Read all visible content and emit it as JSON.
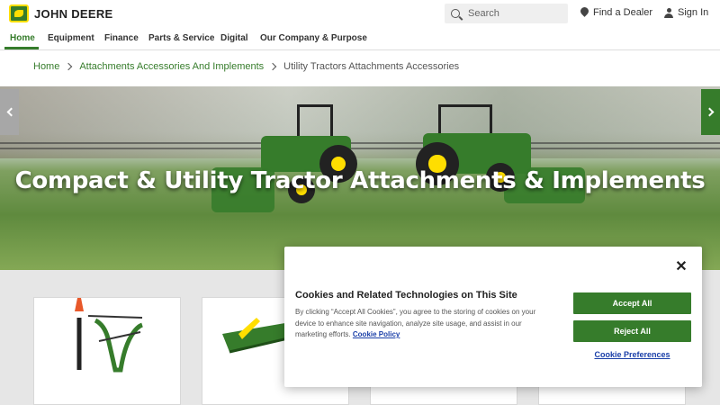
{
  "header": {
    "brand": "JOHN DEERE",
    "search_placeholder": "Search",
    "find_dealer": "Find a Dealer",
    "sign_in": "Sign In"
  },
  "nav": {
    "items": [
      {
        "label": "Home",
        "active": true
      },
      {
        "label": "Equipment"
      },
      {
        "label": "Finance"
      },
      {
        "label": "Parts & Service"
      },
      {
        "label": "Digital"
      },
      {
        "label": "Our Company & Purpose"
      }
    ]
  },
  "breadcrumb": {
    "items": [
      "Home",
      "Attachments Accessories And Implements"
    ],
    "current": "Utility Tractors Attachments Accessories"
  },
  "hero": {
    "title": "Compact & Utility Tractor Attachments & Implements"
  },
  "cookie": {
    "title": "Cookies and Related Technologies on This Site",
    "body": "By clicking “Accept All Cookies”, you agree to the storing of cookies on your device to enhance site navigation, analyze site usage, and assist in our marketing efforts.",
    "policy_link": "Cookie Policy",
    "accept": "Accept All",
    "reject": "Reject All",
    "preferences": "Cookie Preferences",
    "close": "✕"
  },
  "colors": {
    "brand_green": "#367c2b",
    "brand_yellow": "#ffde00",
    "link_blue": "#1a3fa8"
  }
}
